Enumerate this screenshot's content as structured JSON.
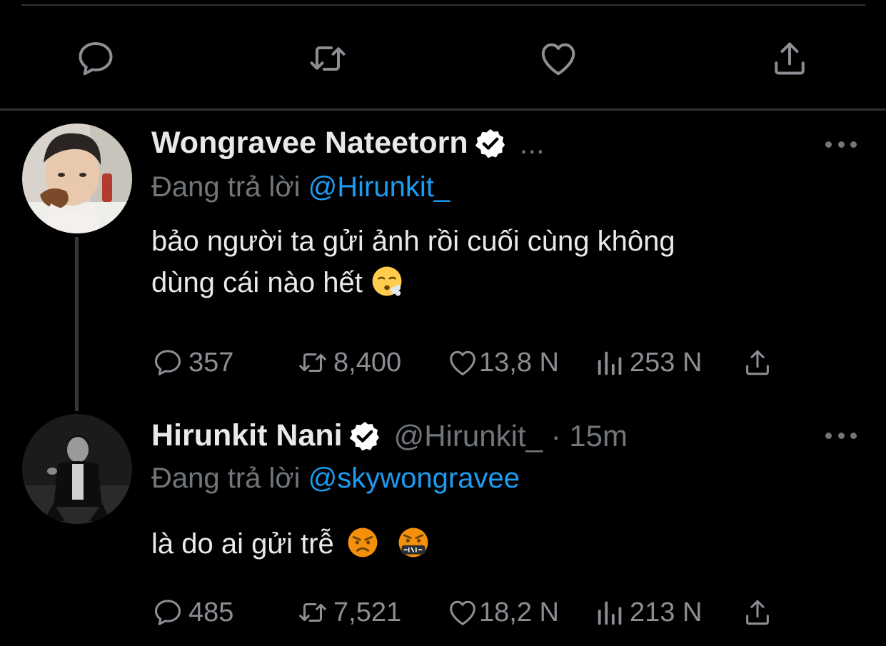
{
  "main_tweet_actions": {
    "reply_icon": "reply-icon",
    "retweet_icon": "retweet-icon",
    "like_icon": "heart-icon",
    "share_icon": "share-icon"
  },
  "tweets": [
    {
      "name": "Wongravee Nateetorn",
      "handle": "...",
      "verified": true,
      "reply_prefix": "Đang trả lời",
      "reply_to": "@Hirunkit_",
      "text_line1": "bảo người ta gửi ảnh rồi cuối cùng không",
      "text_line2": "dùng cái nào hết",
      "emojis": [
        "face-exhaling"
      ],
      "stats": {
        "replies": "357",
        "retweets": "8,400",
        "likes": "13,8 N",
        "views": "253 N"
      }
    },
    {
      "name": "Hirunkit Nani",
      "handle": "@Hirunkit_ · 15m",
      "verified": true,
      "reply_prefix": "Đang trả lời",
      "reply_to": "@skywongravee",
      "text_line1": "là do ai gửi trễ",
      "emojis": [
        "angry-face",
        "face-with-symbols-on-mouth"
      ],
      "stats": {
        "replies": "485",
        "retweets": "7,521",
        "likes": "18,2 N",
        "views": "213 N"
      }
    }
  ],
  "colors": {
    "background": "#000000",
    "text": "#e7e9ea",
    "muted": "#71767b",
    "link": "#1d9bf0",
    "divider": "#2f3336"
  }
}
